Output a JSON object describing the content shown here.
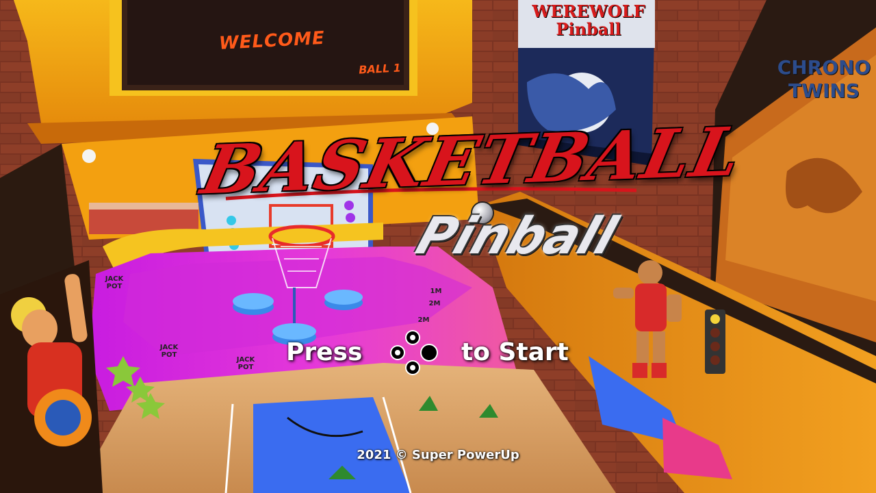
{
  "title": {
    "main": "BASKETBALL",
    "sub": "Pinball"
  },
  "prompt": {
    "press": "Press",
    "to_start": "to Start",
    "button_icon": "face-buttons-right-icon"
  },
  "footer": {
    "copyright": "2021 © Super PowerUp"
  },
  "scene": {
    "marquee_text": "WELCOME",
    "marquee_ball": "BALL 1",
    "poster_title": "WEREWOLF\nPinball",
    "cabinet_title": "CHRONO\nTWINS",
    "playfield_labels": [
      "JACK POT",
      "JACK POT",
      "JACK POT",
      "2M",
      "2M",
      "1M"
    ]
  },
  "colors": {
    "title_red": "#d8141c",
    "marquee_orange": "#ff5a1a",
    "playfield_magenta": "#e01ee8",
    "playfield_blue": "#3a6cf0",
    "cabinet_yellow": "#f4b414",
    "wood": "#d9a46a",
    "brick": "#7a3322"
  }
}
